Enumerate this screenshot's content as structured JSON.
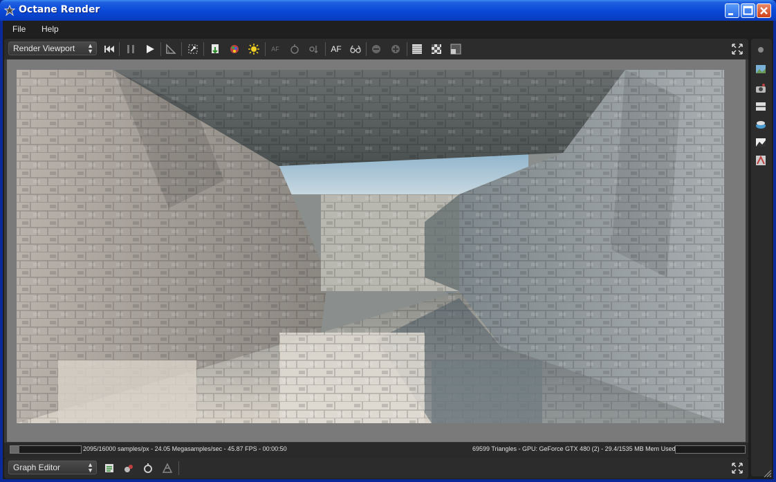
{
  "window": {
    "title": "Octane Render"
  },
  "menu": {
    "file": "File",
    "help": "Help"
  },
  "toolbar": {
    "view_select": "Render Viewport",
    "autofocus_label": "AF",
    "autofocus_small": "AF"
  },
  "status": {
    "progress": 0.1309,
    "left_text": "2095/16000 samples/px - 24.05 Megasamples/sec - 45.87 FPS - 00:00:50",
    "right_text": "69599 Triangles - GPU: GeForce GTX 480 (2) - 29.4/1535 MB Mem Used"
  },
  "bottom": {
    "editor_select": "Graph Editor"
  },
  "colors": {
    "title_bar": "#0a4ad8",
    "panel": "#2c2c2c",
    "viewport_bg": "#7a7a7a",
    "accent_yellow": "#f0d020"
  },
  "icons": [
    "app-icon",
    "reset-icon",
    "pause-icon",
    "play-icon",
    "ruler-icon",
    "region-icon",
    "load-icon",
    "color-icon",
    "light-icon",
    "af-icon",
    "focus-icon",
    "pick-icon",
    "stereo-icon",
    "lock-icon",
    "unlock-icon",
    "checker-icon",
    "alpha-icon",
    "fit-icon",
    "fullscreen-icon"
  ]
}
